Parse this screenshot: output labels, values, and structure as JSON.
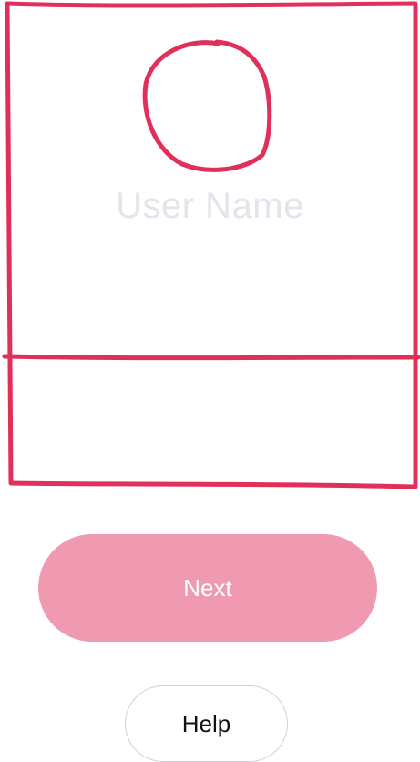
{
  "profile": {
    "username_placeholder": "User Name"
  },
  "actions": {
    "next_label": "Next",
    "help_label": "Help"
  },
  "colors": {
    "sketch_stroke": "#e0305a",
    "next_button_bg": "#ef9ab0",
    "placeholder_text": "#e4e5ec"
  },
  "icons": {
    "avatar": "avatar-circle-sketch"
  }
}
